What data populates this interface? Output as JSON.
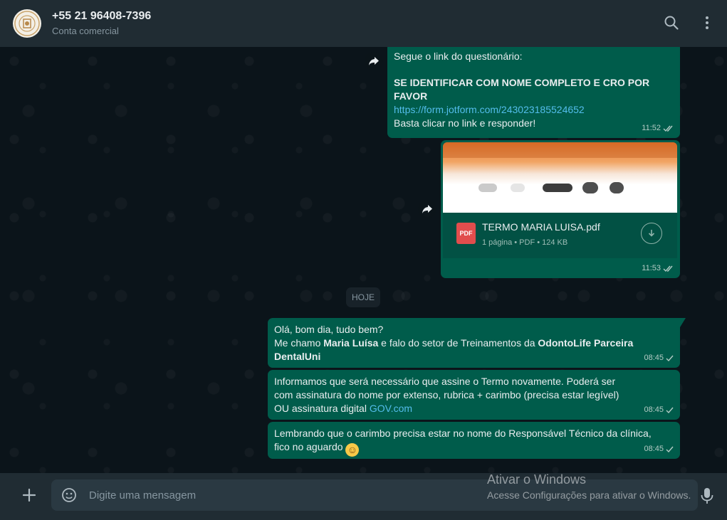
{
  "header": {
    "contact_name": "+55 21 96408-7396",
    "contact_sub": "Conta comercial",
    "search_icon": "search-icon",
    "menu_icon": "kebab-menu-icon"
  },
  "messages": [
    {
      "line1": "Segue o link do questionário:",
      "line2": "SE IDENTIFICAR COM NOME COMPLETO E CRO POR FAVOR",
      "link": "https://form.jotform.com/243023185524652",
      "line3": "Basta clicar no link e responder!",
      "time": "11:52"
    },
    {
      "file_name": "TERMO MARIA LUISA.pdf",
      "file_meta": "1 página • PDF • 124 KB",
      "file_badge": "PDF",
      "time": "11:53"
    },
    {
      "p1": "Olá, bom dia, tudo bem?",
      "p2a": "Me chamo ",
      "p2b": "Maria Luísa",
      "p2c": " e falo do setor de Treinamentos da ",
      "p2d": "OdontoLife Parceira DentalUni",
      "time": "08:45"
    },
    {
      "text": "Informamos que será necessário que assine o Termo novamente. Poderá ser com assinatura do nome por extenso, rubrica + carimbo (precisa estar legível) OU assinatura digital ",
      "link": "GOV.com",
      "time": "08:45"
    },
    {
      "text": "Lembrando que o carimbo precisa estar no nome do Responsável Técnico da clínica, fico no aguardo ",
      "emoji": "☺",
      "time": "08:45"
    }
  ],
  "date_divider": "HOJE",
  "composer": {
    "placeholder": "Digite uma mensagem"
  },
  "watermark": {
    "title": "Ativar o Windows",
    "subtitle": "Acesse Configurações para ativar o Windows."
  },
  "colors": {
    "outgoing_bubble": "#005c4b",
    "header": "#202c33",
    "link": "#53bdeb",
    "background": "#0b141a"
  }
}
